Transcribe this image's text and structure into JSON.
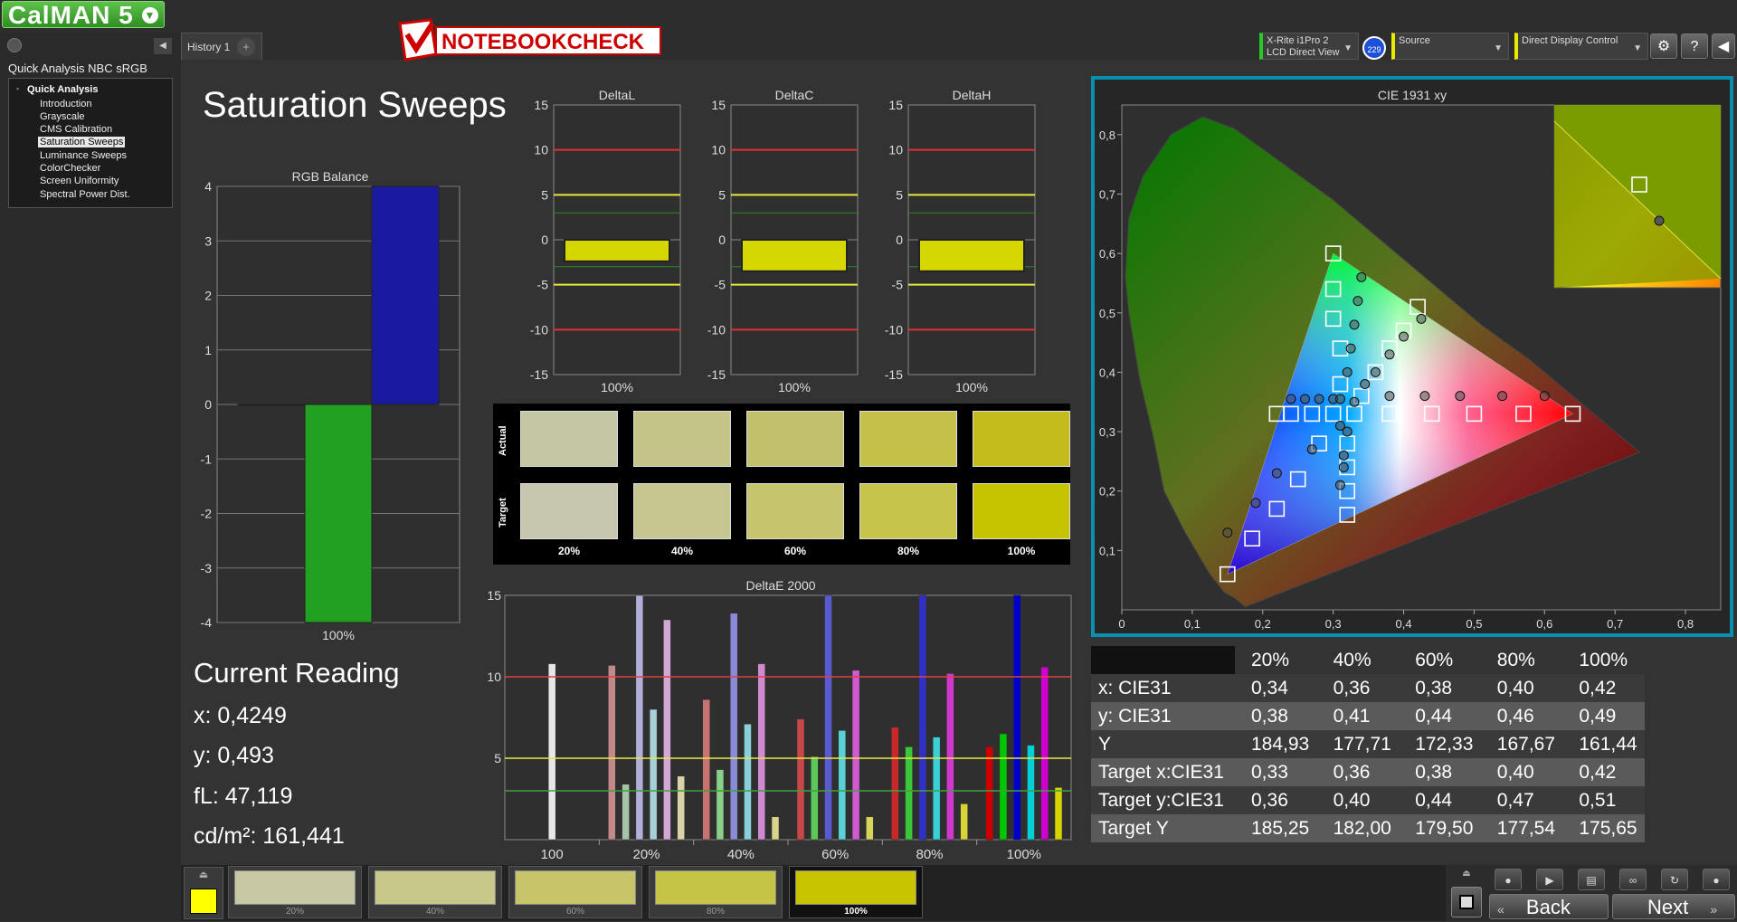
{
  "app": {
    "logo_text": "CalMAN 5",
    "history_tab": "History 1",
    "site_logo": "NOTEBOOKCHECK"
  },
  "toolbar": {
    "meter_line1": "X-Rite i1Pro 2",
    "meter_line2": "LCD Direct View",
    "meter_badge": "229",
    "source_label": "Source",
    "display_label": "Direct Display Control",
    "settings_icon": "gear-icon",
    "help_icon": "question-icon",
    "back_icon": "chevron-left-icon"
  },
  "sidebar": {
    "title": "Quick Analysis NBC sRGB",
    "root": "Quick Analysis",
    "items": [
      {
        "label": "Introduction"
      },
      {
        "label": "Grayscale"
      },
      {
        "label": "CMS Calibration"
      },
      {
        "label": "Saturation Sweeps",
        "selected": true
      },
      {
        "label": "Luminance Sweeps"
      },
      {
        "label": "ColorChecker"
      },
      {
        "label": "Screen Uniformity"
      },
      {
        "label": "Spectral Power Dist."
      }
    ]
  },
  "page": {
    "title": "Saturation Sweeps"
  },
  "current_reading": {
    "title": "Current Reading",
    "x": "x: 0,4249",
    "y": "y: 0,493",
    "fl": "fL: 47,119",
    "cdm2": "cd/m²: 161,441"
  },
  "swatches": {
    "actual_label": "Actual",
    "target_label": "Target",
    "labels": [
      "20%",
      "40%",
      "60%",
      "80%",
      "100%"
    ],
    "actual_colors": [
      "#c4c6a4",
      "#c4c488",
      "#c2c06c",
      "#c4c04a",
      "#c4bc1c"
    ],
    "target_colors": [
      "#c6c6ae",
      "#c6c690",
      "#c6c46c",
      "#c6c44a",
      "#c6c400"
    ]
  },
  "table": {
    "headers": [
      "20%",
      "40%",
      "60%",
      "80%",
      "100%"
    ],
    "rows": [
      {
        "label": "x: CIE31",
        "values": [
          "0,34",
          "0,36",
          "0,38",
          "0,40",
          "0,42"
        ]
      },
      {
        "label": "y: CIE31",
        "values": [
          "0,38",
          "0,41",
          "0,44",
          "0,46",
          "0,49"
        ]
      },
      {
        "label": "Y",
        "values": [
          "184,93",
          "177,71",
          "172,33",
          "167,67",
          "161,44"
        ]
      },
      {
        "label": "Target x:CIE31",
        "values": [
          "0,33",
          "0,36",
          "0,38",
          "0,40",
          "0,42"
        ]
      },
      {
        "label": "Target y:CIE31",
        "values": [
          "0,36",
          "0,40",
          "0,44",
          "0,47",
          "0,51"
        ]
      },
      {
        "label": "Target Y",
        "values": [
          "185,25",
          "182,00",
          "179,50",
          "177,54",
          "175,65"
        ]
      }
    ]
  },
  "bottom_strip": {
    "current_color": "#ffff00",
    "items": [
      {
        "label": "20%",
        "color": "#c8c8a4"
      },
      {
        "label": "40%",
        "color": "#c8c88a"
      },
      {
        "label": "60%",
        "color": "#c8c46a"
      },
      {
        "label": "80%",
        "color": "#c6c446"
      },
      {
        "label": "100%",
        "color": "#c8c400",
        "selected": true
      }
    ],
    "back_label": "Back",
    "next_label": "Next"
  },
  "chart_data": [
    {
      "type": "bar",
      "title": "RGB Balance",
      "categories": [
        "100%"
      ],
      "series": [
        {
          "name": "Red",
          "values": [
            0
          ],
          "color": "#cc0000"
        },
        {
          "name": "Green",
          "values": [
            -4
          ],
          "color": "#22a022"
        },
        {
          "name": "Blue",
          "values": [
            4
          ],
          "color": "#1a1aa0"
        }
      ],
      "ylim": [
        -4,
        4
      ],
      "yticks": [
        "4",
        "3",
        "2",
        "1",
        "0",
        "-1",
        "-2",
        "-3",
        "-4"
      ],
      "grid": true
    },
    {
      "type": "bar",
      "title": "DeltaL",
      "categories": [
        "100%"
      ],
      "values": [
        -2.4
      ],
      "ylim": [
        -15,
        15
      ],
      "yticks": [
        "15",
        "10",
        "5",
        "0",
        "-5",
        "-10",
        "-15"
      ]
    },
    {
      "type": "bar",
      "title": "DeltaC",
      "categories": [
        "100%"
      ],
      "values": [
        -3.5
      ],
      "ylim": [
        -15,
        15
      ],
      "yticks": [
        "15",
        "10",
        "5",
        "0",
        "-5",
        "-10",
        "-15"
      ]
    },
    {
      "type": "bar",
      "title": "DeltaH",
      "categories": [
        "100%"
      ],
      "values": [
        -3.5
      ],
      "ylim": [
        -15,
        15
      ],
      "yticks": [
        "15",
        "10",
        "5",
        "0",
        "-5",
        "-10",
        "-15"
      ]
    },
    {
      "type": "bar",
      "title": "DeltaE 2000",
      "categories": [
        "100",
        "20%",
        "40%",
        "60%",
        "80%",
        "100%"
      ],
      "ylim": [
        0,
        15
      ],
      "yticks": [
        "15",
        "10",
        "5"
      ],
      "groups": [
        {
          "category": "100",
          "bars": [
            {
              "value": 10.8,
              "color": "#e8e8e8"
            }
          ]
        },
        {
          "category": "20%",
          "bars": [
            {
              "value": 10.7,
              "color": "#c48a8a"
            },
            {
              "value": 3.4,
              "color": "#a8c4a8"
            },
            {
              "value": 15,
              "color": "#b0b0d8"
            },
            {
              "value": 8,
              "color": "#a8d0d8"
            },
            {
              "value": 13.5,
              "color": "#d4a8d4"
            },
            {
              "value": 3.9,
              "color": "#d8d4a8"
            }
          ]
        },
        {
          "category": "40%",
          "bars": [
            {
              "value": 8.6,
              "color": "#c87272"
            },
            {
              "value": 4.3,
              "color": "#8ad08a"
            },
            {
              "value": 13.9,
              "color": "#8a8ad8"
            },
            {
              "value": 7.1,
              "color": "#8ad0d8"
            },
            {
              "value": 10.8,
              "color": "#d08ad0"
            },
            {
              "value": 1.4,
              "color": "#d8d48a"
            }
          ]
        },
        {
          "category": "60%",
          "bars": [
            {
              "value": 7.4,
              "color": "#c84848"
            },
            {
              "value": 5.1,
              "color": "#5ac85a"
            },
            {
              "value": 15,
              "color": "#5a5ad0"
            },
            {
              "value": 6.7,
              "color": "#5ad0d8"
            },
            {
              "value": 10.4,
              "color": "#d05ad0"
            },
            {
              "value": 1.4,
              "color": "#d8d45a"
            }
          ]
        },
        {
          "category": "80%",
          "bars": [
            {
              "value": 6.9,
              "color": "#c82828"
            },
            {
              "value": 5.7,
              "color": "#3ac83a"
            },
            {
              "value": 15,
              "color": "#3030c8"
            },
            {
              "value": 6.3,
              "color": "#3ad0d8"
            },
            {
              "value": 10.2,
              "color": "#d038d0"
            },
            {
              "value": 2.2,
              "color": "#d8d438"
            }
          ]
        },
        {
          "category": "100%",
          "bars": [
            {
              "value": 5.7,
              "color": "#cc0000"
            },
            {
              "value": 6.5,
              "color": "#00c800"
            },
            {
              "value": 15,
              "color": "#0000c8"
            },
            {
              "value": 5.8,
              "color": "#00d0d8"
            },
            {
              "value": 10.6,
              "color": "#d000d0"
            },
            {
              "value": 3.2,
              "color": "#d8d400"
            }
          ]
        }
      ],
      "reference_lines": [
        {
          "value": 10,
          "color": "#e04040"
        },
        {
          "value": 5,
          "color": "#e8e840"
        },
        {
          "value": 3,
          "color": "#40a040"
        }
      ]
    },
    {
      "type": "scatter",
      "title": "CIE 1931 xy",
      "xlim": [
        0,
        0.85
      ],
      "ylim": [
        0,
        0.85
      ],
      "xticks": [
        "0",
        "0,1",
        "0,2",
        "0,3",
        "0,4",
        "0,5",
        "0,6",
        "0,7",
        "0,8"
      ],
      "yticks": [
        "0,8",
        "0,7",
        "0,6",
        "0,5",
        "0,4",
        "0,3",
        "0,2",
        "0,1"
      ],
      "gamut_triangle": [
        [
          0.64,
          0.33
        ],
        [
          0.3,
          0.6
        ],
        [
          0.15,
          0.06
        ]
      ],
      "target_points": [
        [
          0.64,
          0.33
        ],
        [
          0.57,
          0.33
        ],
        [
          0.5,
          0.33
        ],
        [
          0.44,
          0.33
        ],
        [
          0.38,
          0.33
        ],
        [
          0.33,
          0.33
        ],
        [
          0.3,
          0.6
        ],
        [
          0.3,
          0.54
        ],
        [
          0.3,
          0.49
        ],
        [
          0.31,
          0.44
        ],
        [
          0.31,
          0.38
        ],
        [
          0.15,
          0.06
        ],
        [
          0.185,
          0.12
        ],
        [
          0.22,
          0.17
        ],
        [
          0.25,
          0.22
        ],
        [
          0.28,
          0.28
        ],
        [
          0.3,
          0.33
        ],
        [
          0.27,
          0.33
        ],
        [
          0.24,
          0.33
        ],
        [
          0.22,
          0.33
        ],
        [
          0.32,
          0.28
        ],
        [
          0.32,
          0.24
        ],
        [
          0.32,
          0.2
        ],
        [
          0.32,
          0.16
        ],
        [
          0.42,
          0.51
        ],
        [
          0.4,
          0.47
        ],
        [
          0.38,
          0.44
        ],
        [
          0.36,
          0.4
        ],
        [
          0.34,
          0.36
        ]
      ],
      "measured_points": [
        [
          0.6,
          0.36
        ],
        [
          0.54,
          0.36
        ],
        [
          0.48,
          0.36
        ],
        [
          0.43,
          0.36
        ],
        [
          0.38,
          0.36
        ],
        [
          0.33,
          0.35
        ],
        [
          0.34,
          0.56
        ],
        [
          0.335,
          0.52
        ],
        [
          0.33,
          0.48
        ],
        [
          0.325,
          0.44
        ],
        [
          0.32,
          0.4
        ],
        [
          0.15,
          0.13
        ],
        [
          0.19,
          0.18
        ],
        [
          0.22,
          0.23
        ],
        [
          0.27,
          0.27
        ],
        [
          0.31,
          0.31
        ],
        [
          0.24,
          0.355
        ],
        [
          0.26,
          0.355
        ],
        [
          0.28,
          0.355
        ],
        [
          0.3,
          0.355
        ],
        [
          0.31,
          0.355
        ],
        [
          0.32,
          0.3
        ],
        [
          0.315,
          0.26
        ],
        [
          0.315,
          0.24
        ],
        [
          0.31,
          0.21
        ],
        [
          0.425,
          0.49
        ],
        [
          0.4,
          0.46
        ],
        [
          0.38,
          0.43
        ],
        [
          0.36,
          0.4
        ],
        [
          0.345,
          0.38
        ]
      ],
      "inset": {
        "target": [
          0.42,
          0.51
        ],
        "measured": [
          0.425,
          0.49
        ]
      }
    }
  ]
}
